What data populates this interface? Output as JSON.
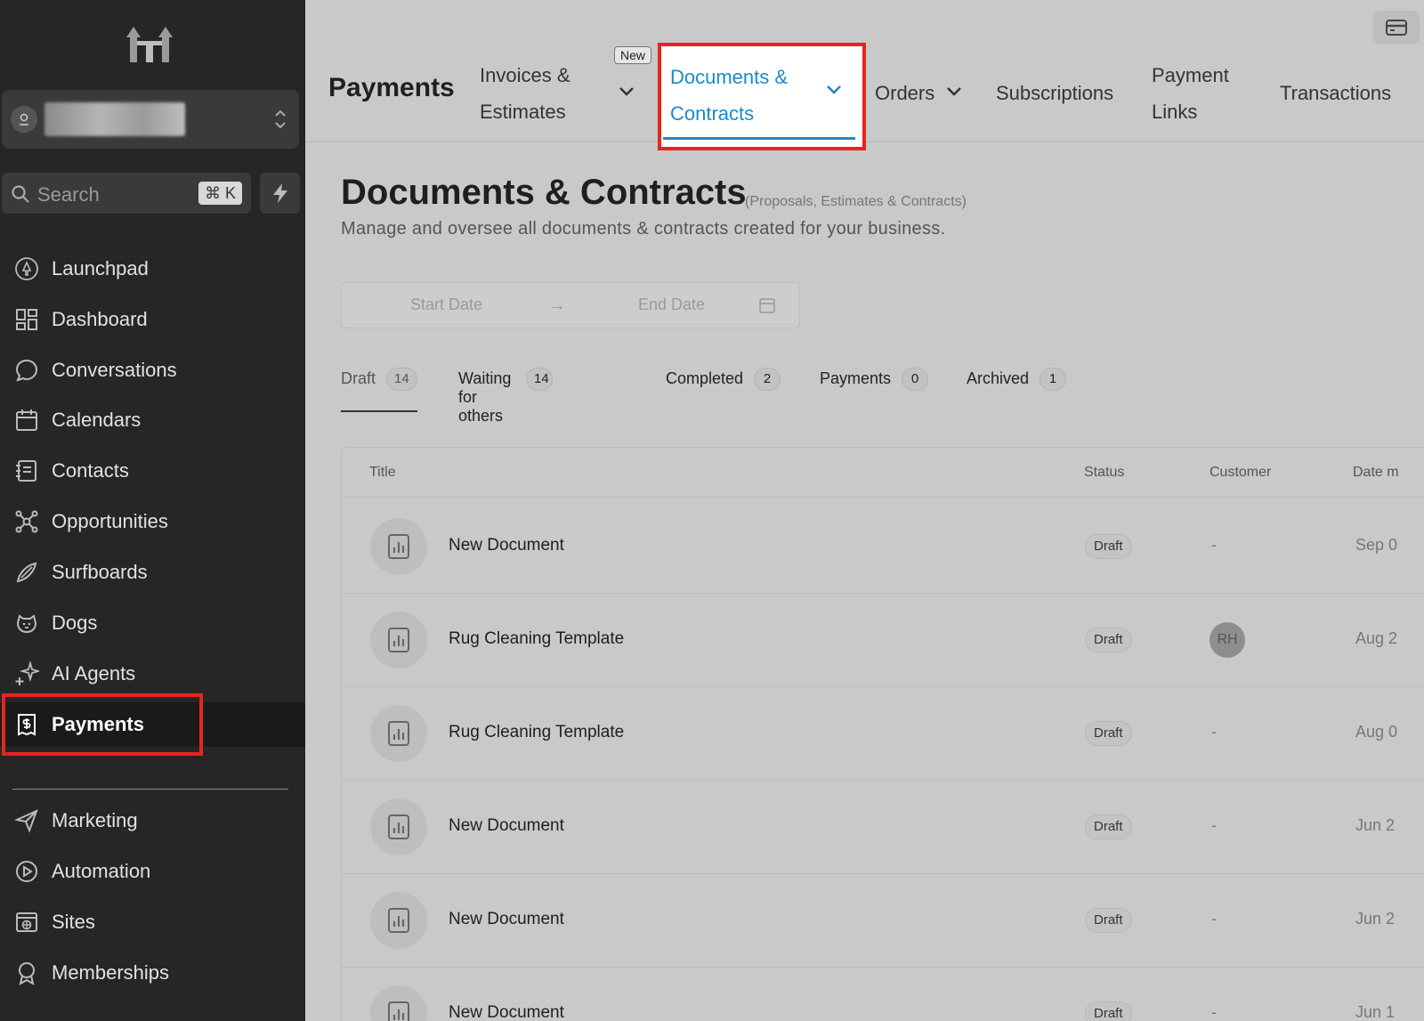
{
  "sidebar": {
    "search": {
      "placeholder": "Search",
      "shortcut": "⌘ K"
    },
    "items": [
      {
        "label": "Launchpad",
        "icon": "rocket-icon"
      },
      {
        "label": "Dashboard",
        "icon": "dashboard-icon"
      },
      {
        "label": "Conversations",
        "icon": "chat-bubble-icon"
      },
      {
        "label": "Calendars",
        "icon": "calendar-icon"
      },
      {
        "label": "Contacts",
        "icon": "address-book-icon"
      },
      {
        "label": "Opportunities",
        "icon": "opportunities-icon"
      },
      {
        "label": "Surfboards",
        "icon": "surfboard-icon"
      },
      {
        "label": "Dogs",
        "icon": "dog-icon"
      },
      {
        "label": "AI Agents",
        "icon": "sparkle-icon"
      },
      {
        "label": "Payments",
        "icon": "receipt-dollar-icon",
        "active": true
      },
      {
        "label": "Marketing",
        "icon": "send-icon"
      },
      {
        "label": "Automation",
        "icon": "play-circle-icon"
      },
      {
        "label": "Sites",
        "icon": "globe-window-icon"
      },
      {
        "label": "Memberships",
        "icon": "award-icon"
      }
    ]
  },
  "topbar": {
    "title": "Payments",
    "tabs": {
      "invoices_line1": "Invoices &",
      "invoices_line2": "Estimates",
      "new_badge": "New",
      "documents_line1": "Documents &",
      "documents_line2": "Contracts",
      "orders": "Orders",
      "subscriptions": "Subscriptions",
      "payment_links_line1": "Payment",
      "payment_links_line2": "Links",
      "transactions": "Transactions"
    }
  },
  "page": {
    "title": "Documents & Contracts",
    "subtitle": "(Proposals, Estimates & Contracts)",
    "description": "Manage and oversee all documents & contracts created for your business.",
    "date_range": {
      "start_placeholder": "Start Date",
      "end_placeholder": "End Date"
    }
  },
  "status_tabs": [
    {
      "label": "Draft",
      "count": "14",
      "active": true
    },
    {
      "label": "Waiting for others",
      "count": "14"
    },
    {
      "label": "Completed",
      "count": "2"
    },
    {
      "label": "Payments",
      "count": "0"
    },
    {
      "label": "Archived",
      "count": "1"
    }
  ],
  "table": {
    "columns": {
      "title": "Title",
      "status": "Status",
      "customer": "Customer",
      "date": "Date m"
    },
    "rows": [
      {
        "title": "New Document",
        "status": "Draft",
        "customer": "-",
        "date": "Sep 0"
      },
      {
        "title": "Rug Cleaning Template",
        "status": "Draft",
        "customer": "RH",
        "date": "Aug 2"
      },
      {
        "title": "Rug Cleaning Template",
        "status": "Draft",
        "customer": "-",
        "date": "Aug 0"
      },
      {
        "title": "New Document",
        "status": "Draft",
        "customer": "-",
        "date": "Jun 2"
      },
      {
        "title": "New Document",
        "status": "Draft",
        "customer": "-",
        "date": "Jun 2"
      },
      {
        "title": "New Document",
        "status": "Draft",
        "customer": "-",
        "date": "Jun 1"
      }
    ]
  },
  "colors": {
    "accent": "#1e88c8",
    "highlight": "#e5251e",
    "sidebar_bg": "#262626"
  }
}
